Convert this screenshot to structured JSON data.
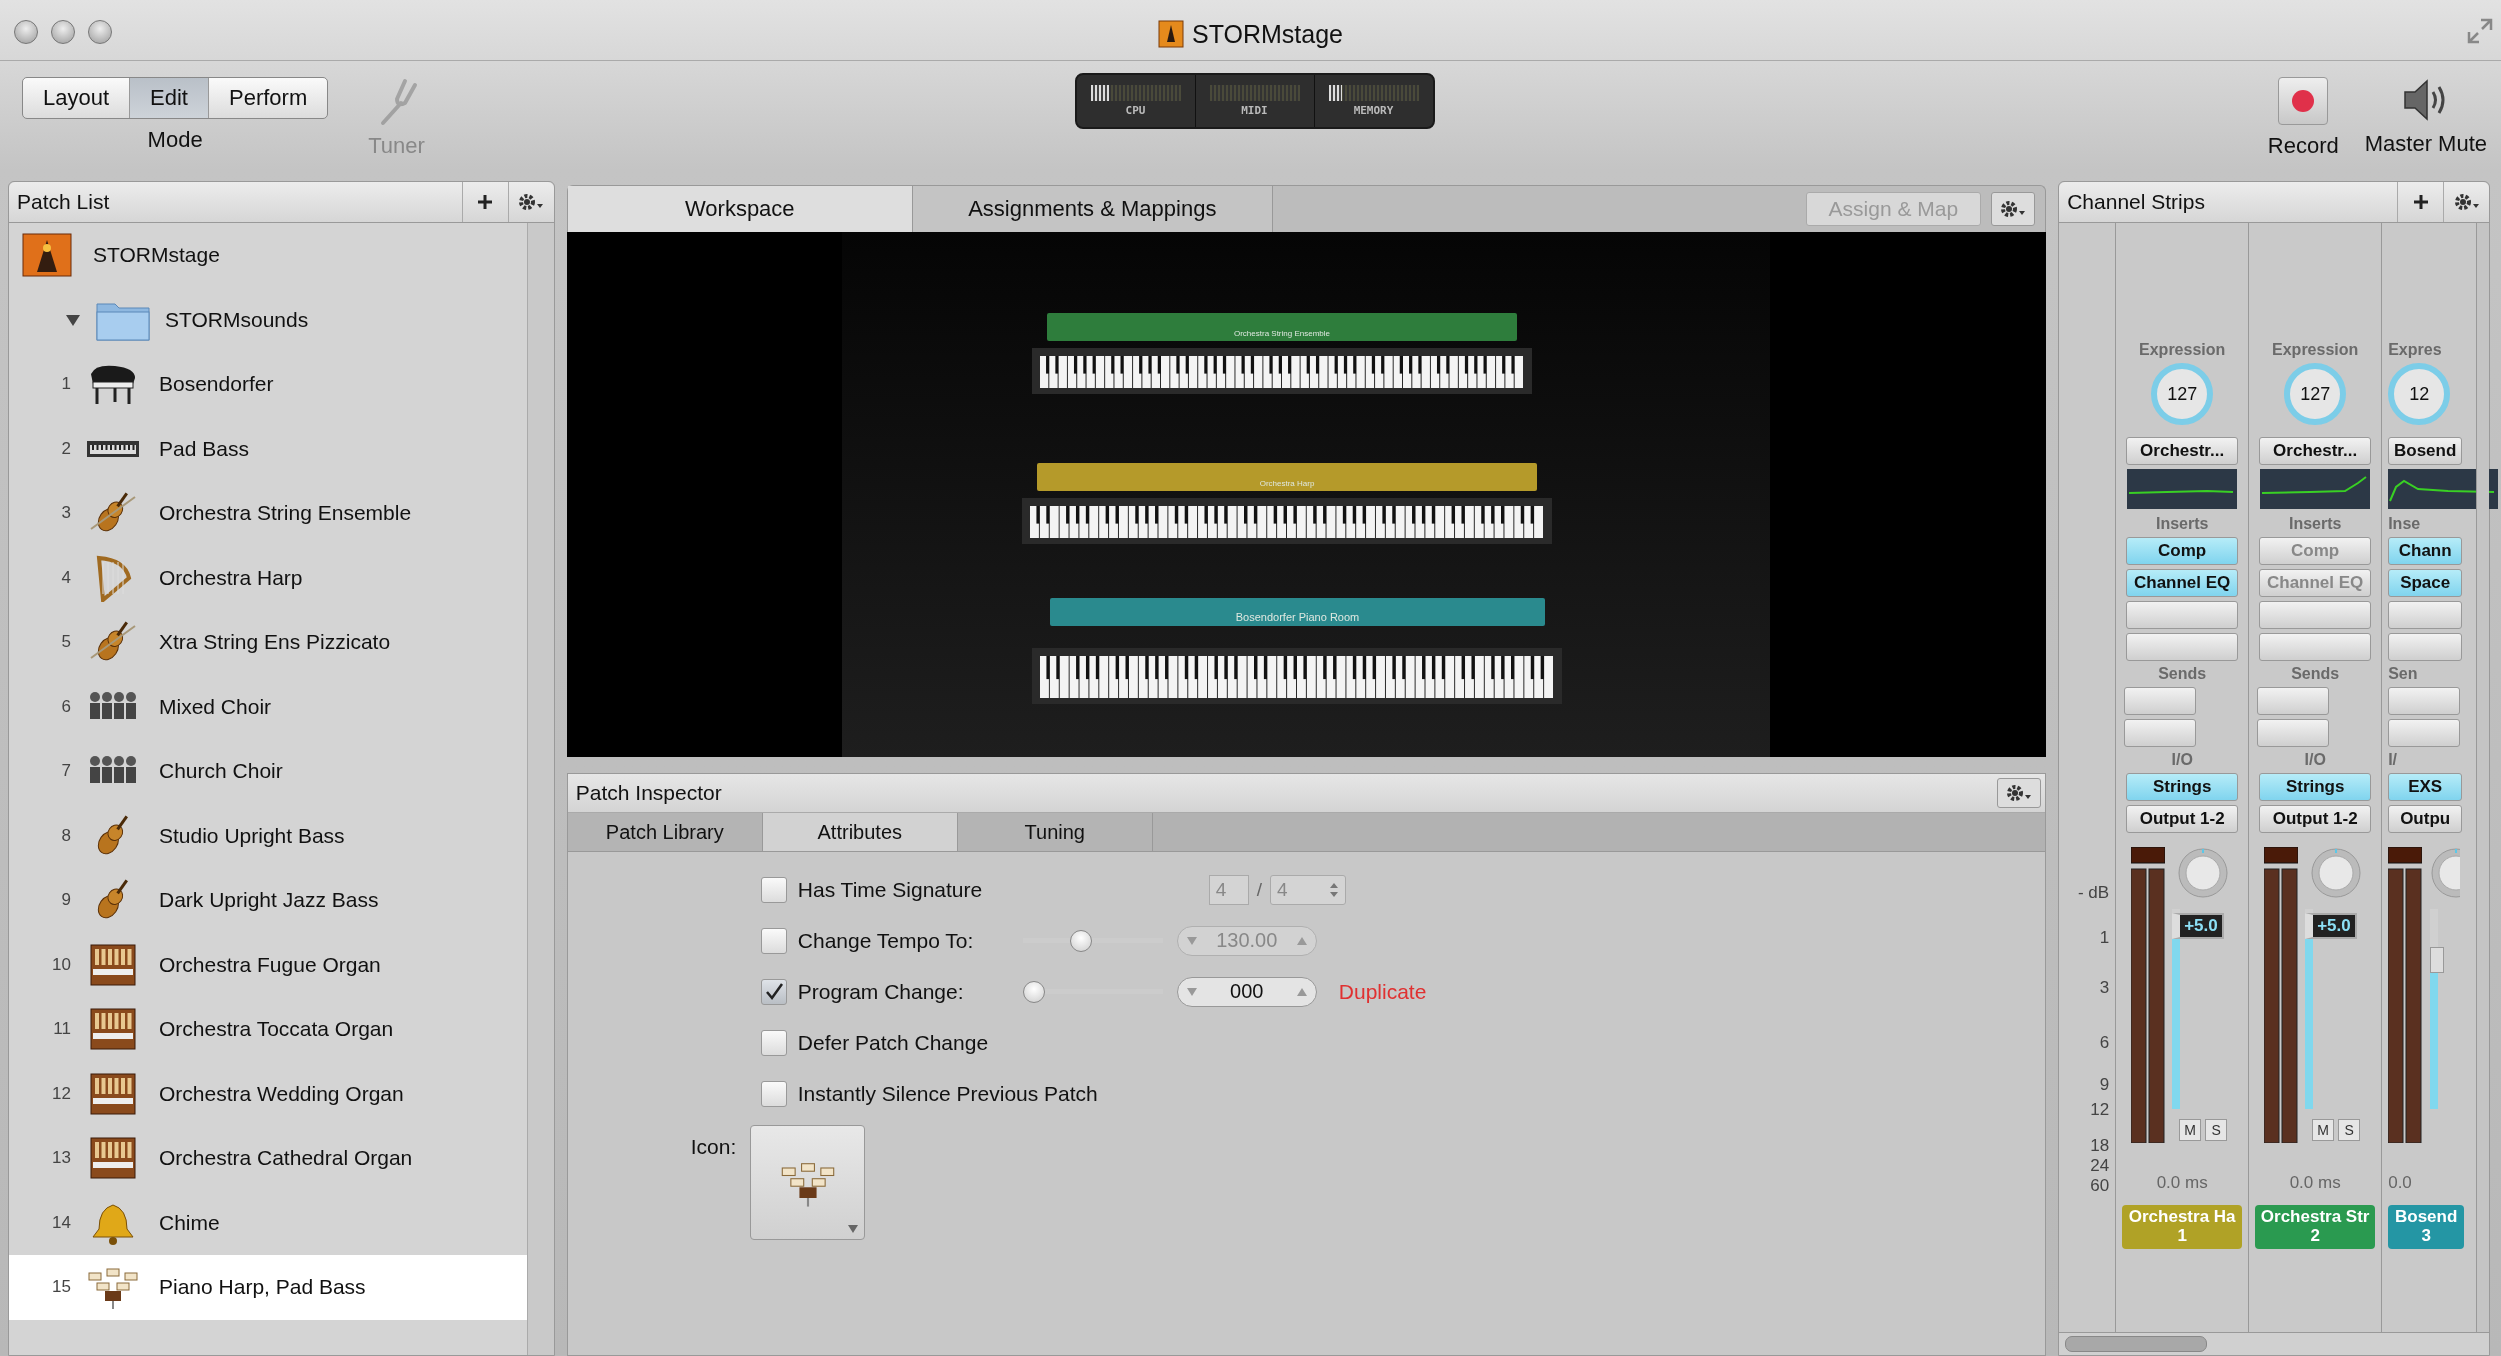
{
  "window": {
    "title": "STORMstage"
  },
  "toolbar": {
    "modes": [
      {
        "label": "Layout",
        "selected": false
      },
      {
        "label": "Edit",
        "selected": true
      },
      {
        "label": "Perform",
        "selected": false
      }
    ],
    "mode_label": "Mode",
    "tuner": {
      "label": "Tuner",
      "disabled": true
    },
    "meters": [
      {
        "label": "CPU",
        "level": 0.2
      },
      {
        "label": "MIDI"
      },
      {
        "label": "MEMORY",
        "level": 0.15
      }
    ],
    "record": {
      "label": "Record"
    },
    "master_mute": {
      "label": "Master Mute"
    }
  },
  "patch_list": {
    "title": "Patch List",
    "root": {
      "name": "STORMstage",
      "children": [
        {
          "name": "STORMsounds",
          "expanded": true,
          "children": [
            {
              "number": "1",
              "name": "Bosendorfer",
              "kind": "piano",
              "selected": false
            },
            {
              "number": "2",
              "name": "Pad Bass",
              "kind": "keyboard",
              "selected": false
            },
            {
              "number": "3",
              "name": "Orchestra String Ensemble",
              "kind": "strings",
              "selected": false
            },
            {
              "number": "4",
              "name": "Orchestra Harp",
              "kind": "harp",
              "selected": false
            },
            {
              "number": "5",
              "name": "Xtra String Ens Pizzicato",
              "kind": "strings",
              "selected": false
            },
            {
              "number": "6",
              "name": "Mixed Choir",
              "kind": "choir",
              "selected": false
            },
            {
              "number": "7",
              "name": "Church Choir",
              "kind": "choir",
              "selected": false
            },
            {
              "number": "8",
              "name": "Studio Upright Bass",
              "kind": "bass",
              "selected": false
            },
            {
              "number": "9",
              "name": "Dark Upright Jazz Bass",
              "kind": "bass",
              "selected": false
            },
            {
              "number": "10",
              "name": "Orchestra Fugue Organ",
              "kind": "organ",
              "selected": false
            },
            {
              "number": "11",
              "name": "Orchestra Toccata Organ",
              "kind": "organ",
              "selected": false
            },
            {
              "number": "12",
              "name": "Orchestra Wedding Organ",
              "kind": "organ",
              "selected": false
            },
            {
              "number": "13",
              "name": "Orchestra Cathedral Organ",
              "kind": "organ",
              "selected": false
            },
            {
              "number": "14",
              "name": "Chime",
              "kind": "bell",
              "selected": false
            },
            {
              "number": "15",
              "name": "Piano Harp, Pad Bass",
              "kind": "stands",
              "selected": true
            }
          ]
        }
      ]
    }
  },
  "workspace": {
    "tabs": [
      {
        "label": "Workspace",
        "selected": true
      },
      {
        "label": "Assignments & Mappings",
        "selected": false
      }
    ],
    "assign_button": {
      "label": "Assign & Map",
      "disabled": true
    },
    "keyboards": [
      {
        "name": "Orchestra String Ensemble",
        "color": "#2e7d3c"
      },
      {
        "name": "Orchestra Harp",
        "color": "#b59a2a"
      },
      {
        "name": "Bosendorfer Piano Room",
        "color": "#2a8a8e"
      }
    ]
  },
  "patch_inspector": {
    "title": "Patch Inspector",
    "tabs": [
      {
        "label": "Patch Library",
        "selected": false
      },
      {
        "label": "Attributes",
        "selected": true
      },
      {
        "label": "Tuning",
        "selected": false
      }
    ],
    "rows": [
      {
        "kind": "signature",
        "label": "Has Time Signature",
        "checked": false,
        "numerator": "4",
        "separator": "/",
        "denominator": "4"
      },
      {
        "kind": "slider",
        "label": "Change Tempo To:",
        "checked": false,
        "level": 0.4,
        "value": "130.00",
        "disabled": true
      },
      {
        "kind": "slider",
        "label": "Program Change:",
        "checked": true,
        "level": 0,
        "value": "000",
        "disabled": false,
        "note": "Duplicate"
      },
      {
        "kind": "plain",
        "label": "Defer Patch Change",
        "checked": false
      },
      {
        "kind": "plain",
        "label": "Instantly Silence Previous Patch",
        "checked": false
      }
    ],
    "icon_label": "Icon:"
  },
  "channel_strips": {
    "title": "Channel Strips",
    "scale": [
      "- dB",
      "1",
      "3",
      "6",
      "9",
      "12",
      "18",
      "24",
      "60"
    ],
    "strips": [
      {
        "clipped": false,
        "expression_label": "Expression",
        "expression_value": "127",
        "patch": "Orchestr...",
        "inserts_label": "Inserts",
        "inserts": [
          {
            "label": "Comp",
            "active": true
          },
          {
            "label": "Channel EQ",
            "active": true
          }
        ],
        "sends_label": "Sends",
        "io_label": "I/O",
        "input": {
          "label": "Strings",
          "active": true
        },
        "output": "Output 1-2",
        "fader": {
          "level": 0.95,
          "reading": "+5.0"
        },
        "mute": "M",
        "solo": "S",
        "delay": "0.0 ms",
        "name": "Orchestra Ha",
        "number": "1",
        "color": "#b0a226"
      },
      {
        "clipped": false,
        "expression_label": "Expression",
        "expression_value": "127",
        "patch": "Orchestr...",
        "inserts_label": "Inserts",
        "inserts": [
          {
            "label": "Comp",
            "active": false
          },
          {
            "label": "Channel EQ",
            "active": false
          }
        ],
        "sends_label": "Sends",
        "io_label": "I/O",
        "input": {
          "label": "Strings",
          "active": true
        },
        "output": "Output 1-2",
        "fader": {
          "level": 0.95,
          "reading": "+5.0"
        },
        "mute": "M",
        "solo": "S",
        "delay": "0.0 ms",
        "name": "Orchestra Str",
        "number": "2",
        "color": "#2a9a50"
      },
      {
        "clipped": true,
        "expression_label": "Expres",
        "expression_value": "12",
        "patch": "Bosend",
        "inserts_label": "Inse",
        "inserts": [
          {
            "label": "Chann",
            "active": true
          },
          {
            "label": "Space",
            "active": true
          }
        ],
        "sends_label": "Sen",
        "io_label": "I/",
        "input": {
          "label": "EXS",
          "active": true
        },
        "output": "Outpu",
        "fader": {
          "level": 0.78
        },
        "delay": "0.0",
        "name": "Bosend",
        "number": "3",
        "color": "#2496a4"
      }
    ]
  }
}
